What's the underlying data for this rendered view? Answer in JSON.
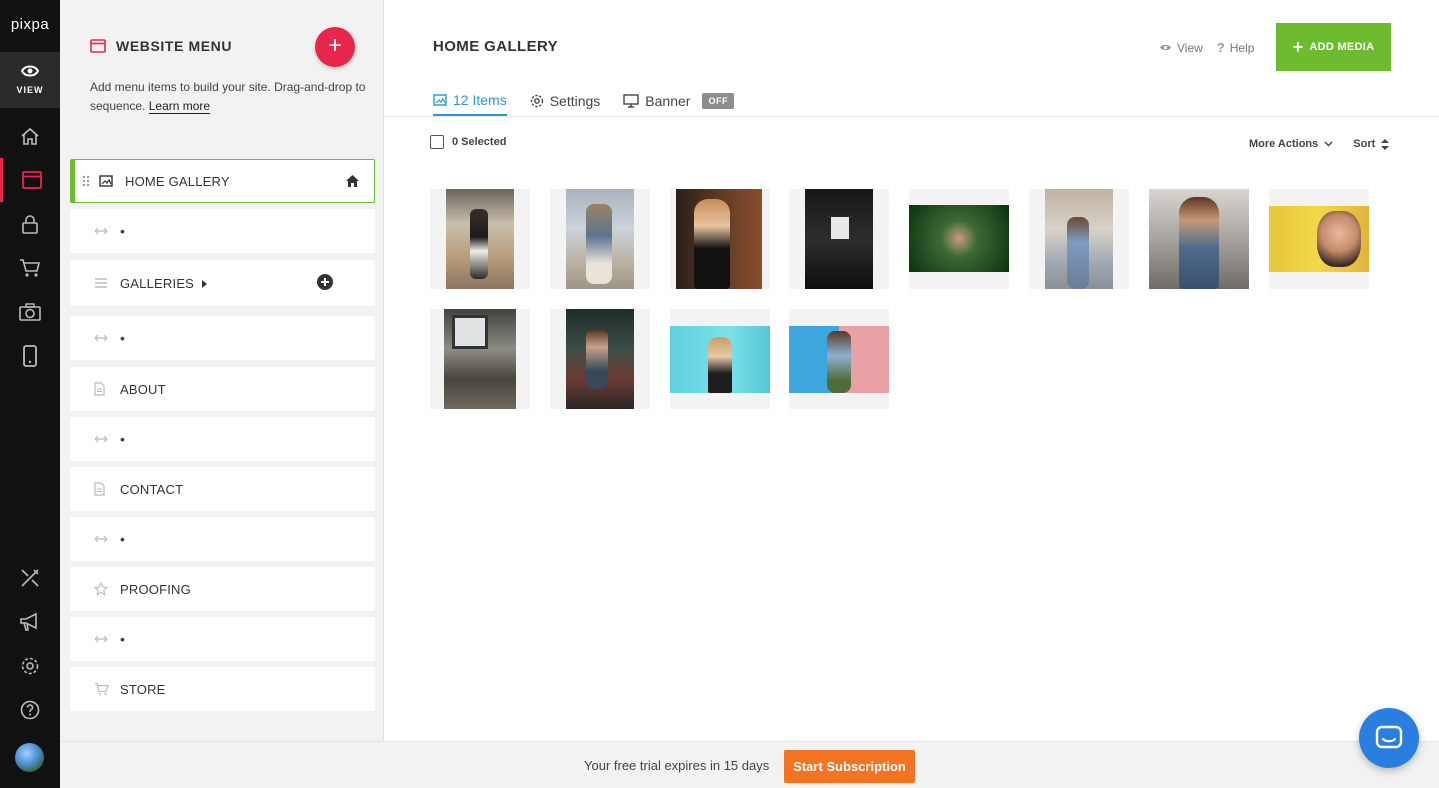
{
  "rail": {
    "logo": "pixpa",
    "view_label": "VIEW",
    "icons": [
      "home-icon",
      "website-icon",
      "lock-icon",
      "cart-icon",
      "camera-icon",
      "mobile-icon",
      "tools-icon",
      "megaphone-icon",
      "gear-icon",
      "help-icon"
    ],
    "accent": "#e8264c"
  },
  "panel": {
    "title": "WEBSITE MENU",
    "add_symbol": "+",
    "desc": "Add menu items to build your site. Drag-and-drop to sequence.",
    "learn_more": "Learn more",
    "items": [
      {
        "label": "HOME GALLERY",
        "icon": "image-icon",
        "active": true
      },
      {
        "label": "•",
        "icon": "spacer-arrows-icon"
      },
      {
        "label": "GALLERIES",
        "icon": "list-icon"
      },
      {
        "label": "•",
        "icon": "spacer-arrows-icon"
      },
      {
        "label": "ABOUT",
        "icon": "page-icon"
      },
      {
        "label": "•",
        "icon": "spacer-arrows-icon"
      },
      {
        "label": "CONTACT",
        "icon": "page-icon"
      },
      {
        "label": "•",
        "icon": "spacer-arrows-icon"
      },
      {
        "label": "PROOFING",
        "icon": "star-icon"
      },
      {
        "label": "•",
        "icon": "spacer-arrows-icon"
      },
      {
        "label": "STORE",
        "icon": "cart-icon"
      }
    ]
  },
  "main": {
    "title": "HOME GALLERY",
    "view_link": "View",
    "help_link": "Help",
    "add_media": "ADD MEDIA",
    "tabs": [
      {
        "label": "12 Items",
        "icon": "image-icon",
        "active": true
      },
      {
        "label": "Settings",
        "icon": "gear-icon"
      },
      {
        "label": "Banner",
        "icon": "monitor-icon",
        "badge": "OFF"
      }
    ],
    "selected": "0 Selected",
    "more_actions": "More Actions",
    "sort": "Sort"
  },
  "footer": {
    "trial_text": "Your free trial expires in 15 days",
    "subscribe": "Start Subscription"
  },
  "colors": {
    "green": "#6dbb2f",
    "blue": "#2a96d6",
    "orange": "#f27321",
    "chat": "#2a7ee0"
  }
}
